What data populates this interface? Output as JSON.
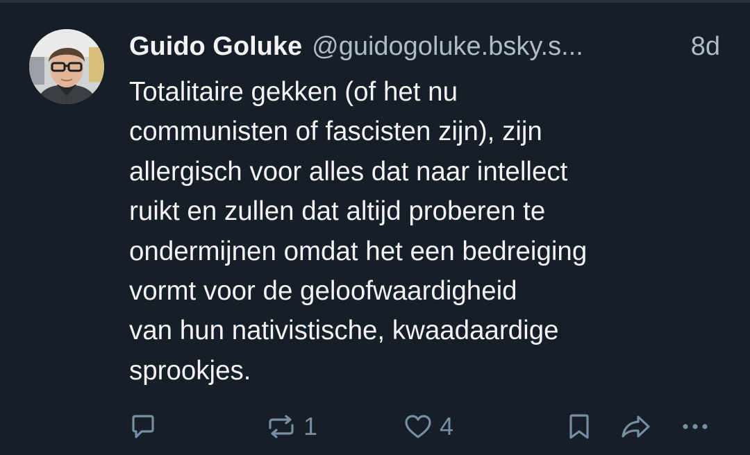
{
  "post": {
    "author_name": "Guido Goluke",
    "author_handle": "@guidogoluke.bsky.s...",
    "time": "8d",
    "text_lines": [
      "Totalitaire gekken (of het nu",
      "communisten of fascisten zijn), zijn",
      "allergisch voor alles dat naar intellect",
      "ruikt en zullen dat altijd proberen te",
      "ondermijnen omdat het een bedreiging",
      "vormt voor de geloofwaardigheid",
      "van hun nativistische, kwaadaardige",
      "sprookjes."
    ]
  },
  "actions": {
    "reply": {
      "icon": "reply-icon",
      "count": ""
    },
    "repost": {
      "icon": "repost-icon",
      "count": "1"
    },
    "like": {
      "icon": "heart-icon",
      "count": "4"
    },
    "bookmark": {
      "icon": "bookmark-icon"
    },
    "share": {
      "icon": "share-icon"
    },
    "more": {
      "icon": "more-icon"
    }
  },
  "colors": {
    "background": "#161e27",
    "text": "#f1f3f5",
    "secondary_text": "#aebbc9",
    "icon": "#788ea5"
  }
}
